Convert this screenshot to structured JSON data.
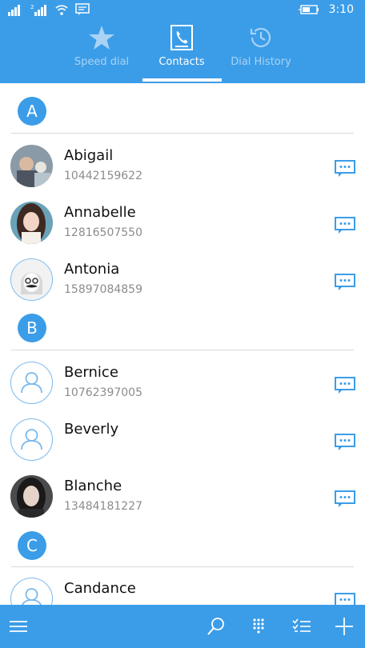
{
  "status_bar": {
    "time": "3:10"
  },
  "tabs": [
    {
      "label": "Speed dial",
      "icon": "star-icon"
    },
    {
      "label": "Contacts",
      "icon": "contacts-book-icon"
    },
    {
      "label": "Dial History",
      "icon": "history-clock-icon"
    }
  ],
  "active_tab": "Contacts",
  "groups": [
    {
      "letter": "A"
    },
    {
      "letter": "B"
    },
    {
      "letter": "C"
    }
  ],
  "contacts": [
    {
      "name": "Abigail",
      "phone": "10442159622",
      "avatar": "photo"
    },
    {
      "name": "Annabelle",
      "phone": "12816507550",
      "avatar": "photo"
    },
    {
      "name": "Antonia",
      "phone": "15897084859",
      "avatar": "photo"
    },
    {
      "name": "Bernice",
      "phone": "10762397005",
      "avatar": "placeholder"
    },
    {
      "name": "Beverly",
      "phone": "",
      "avatar": "placeholder"
    },
    {
      "name": "Blanche",
      "phone": "13484181227",
      "avatar": "photo"
    },
    {
      "name": "Candance",
      "phone": "",
      "avatar": "placeholder"
    }
  ],
  "colors": {
    "accent": "#3b9de8",
    "inactive_tab": "#a9d2f5",
    "separator": "#d9d9d9",
    "secondary_text": "#8c8c8c"
  }
}
